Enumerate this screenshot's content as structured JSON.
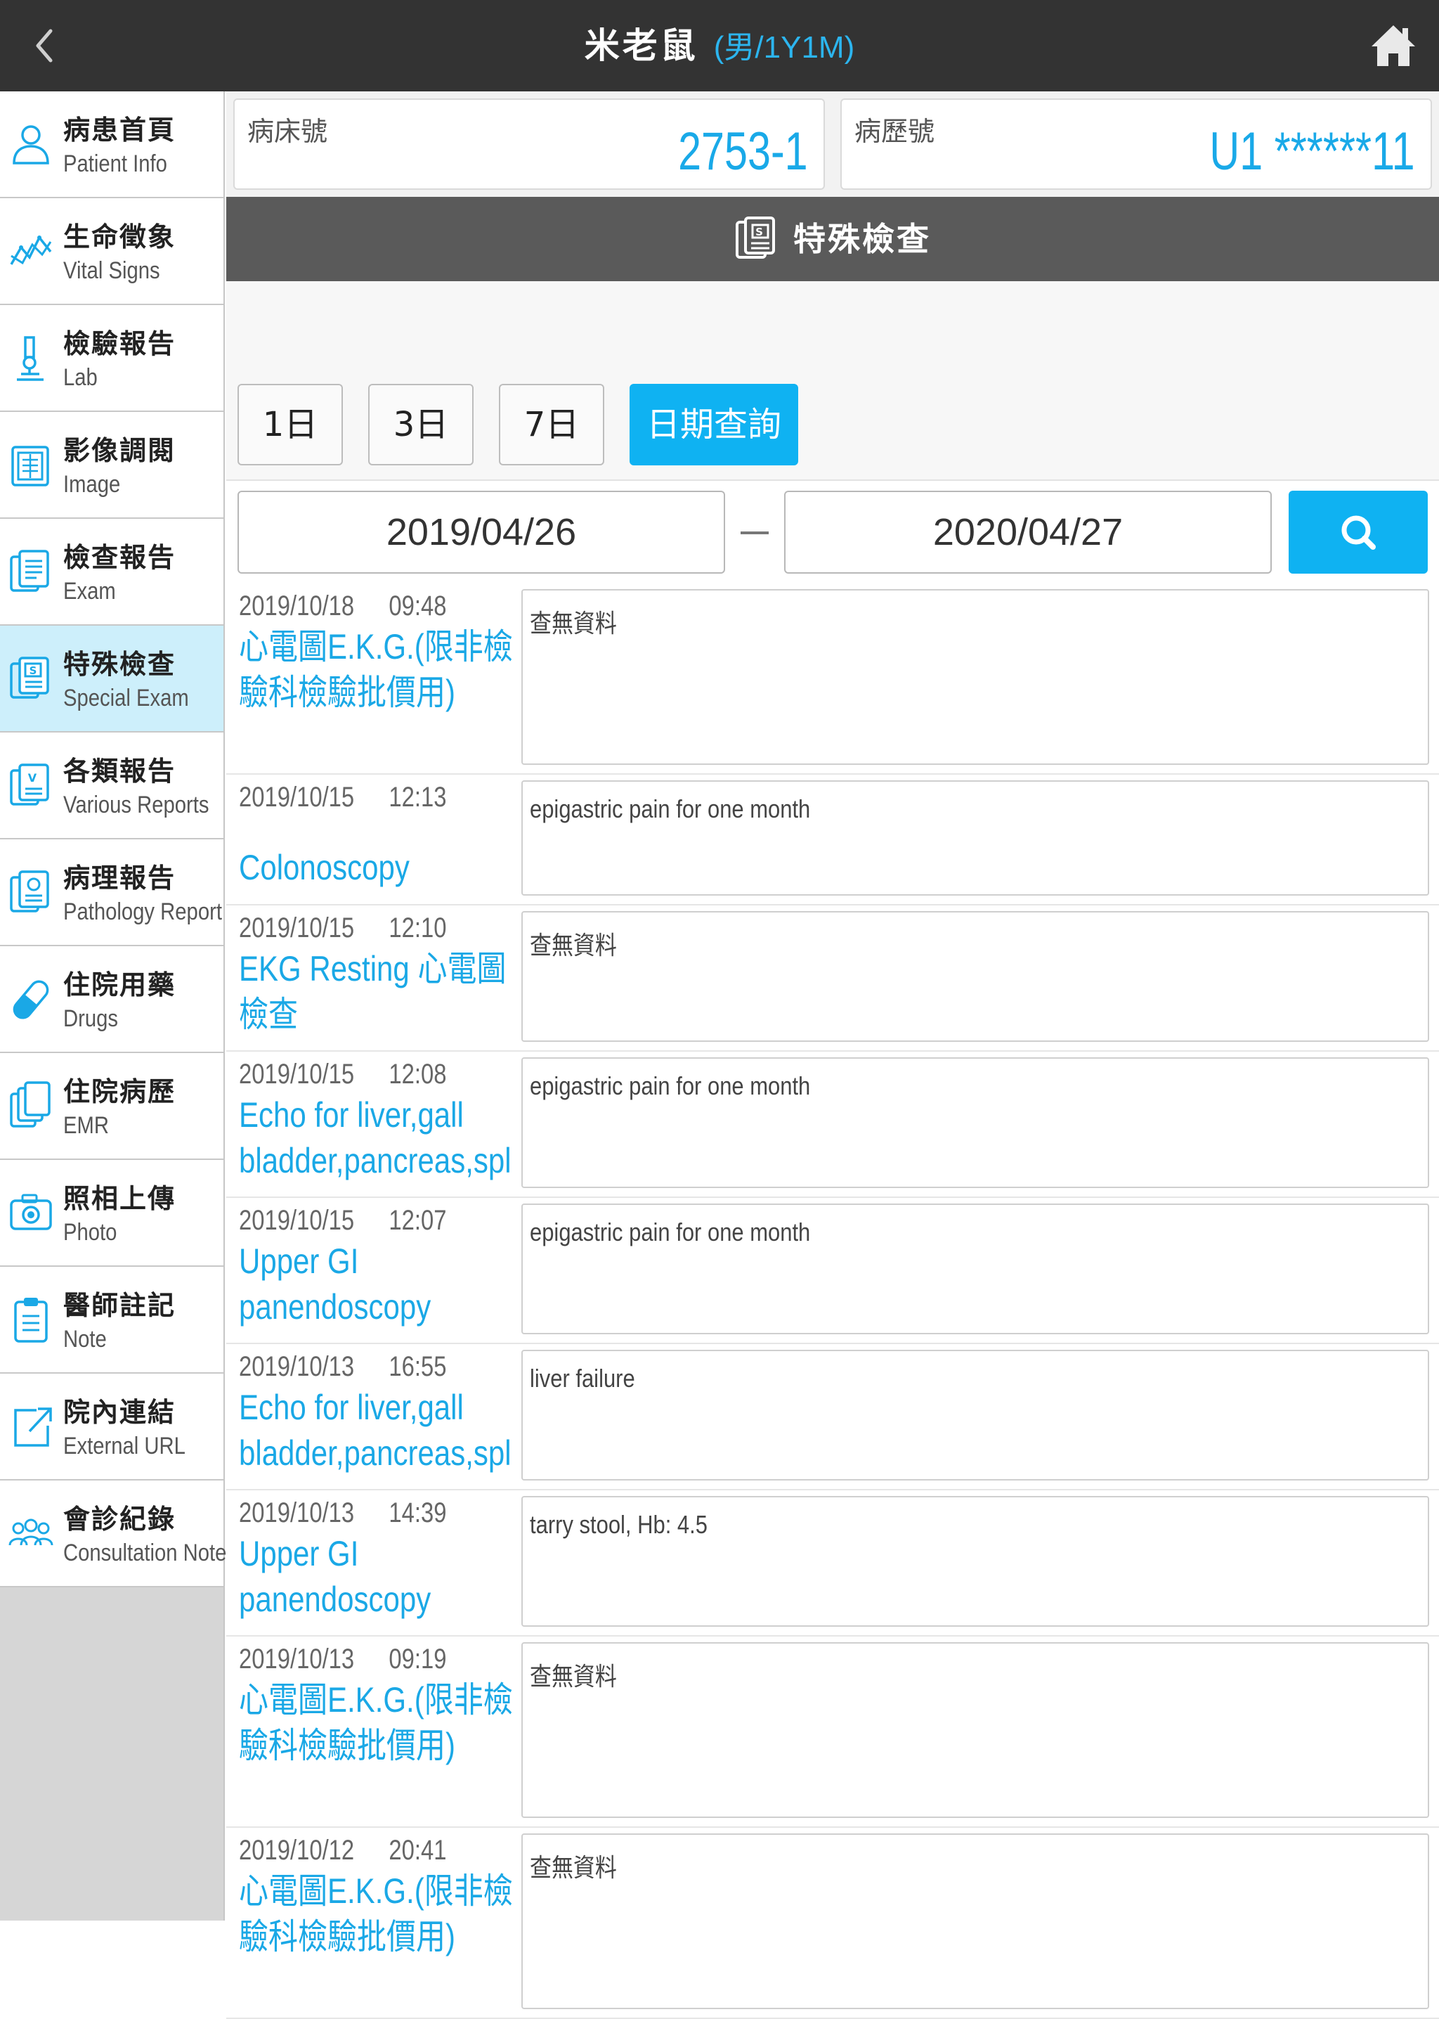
{
  "header": {
    "back_icon": "chevron-left-icon",
    "patient_name": "米老鼠",
    "patient_meta": "(男/1Y1M)",
    "home_icon": "home-icon"
  },
  "sidebar": {
    "items": [
      {
        "zh": "病患首頁",
        "en": "Patient Info",
        "icon": "user-icon"
      },
      {
        "zh": "生命徵象",
        "en": "Vital Signs",
        "icon": "chart-line-icon"
      },
      {
        "zh": "檢驗報告",
        "en": "Lab",
        "icon": "microscope-icon"
      },
      {
        "zh": "影像調閱",
        "en": "Image",
        "icon": "xray-icon"
      },
      {
        "zh": "檢查報告",
        "en": "Exam",
        "icon": "exam-doc-icon"
      },
      {
        "zh": "特殊檢查",
        "en": "Special Exam",
        "icon": "special-exam-icon"
      },
      {
        "zh": "各類報告",
        "en": "Various Reports",
        "icon": "various-reports-icon"
      },
      {
        "zh": "病理報告",
        "en": "Pathology Report",
        "icon": "pathology-icon"
      },
      {
        "zh": "住院用藥",
        "en": "Drugs",
        "icon": "pill-icon"
      },
      {
        "zh": "住院病歷",
        "en": "EMR",
        "icon": "copy-docs-icon"
      },
      {
        "zh": "照相上傳",
        "en": "Photo",
        "icon": "camera-icon"
      },
      {
        "zh": "醫師註記",
        "en": "Note",
        "icon": "clipboard-icon"
      },
      {
        "zh": "院內連結",
        "en": "External URL",
        "icon": "external-link-icon"
      },
      {
        "zh": "會診紀錄",
        "en": "Consultation Note",
        "icon": "group-icon"
      }
    ],
    "active_index": 5
  },
  "info": {
    "bed_label": "病床號",
    "bed_value": "2753-1",
    "chart_label": "病歷號",
    "chart_value": "U1 ******11"
  },
  "section": {
    "title": "特殊檢查",
    "icon": "special-exam-icon"
  },
  "filters": {
    "ranges": [
      "1日",
      "3日",
      "7日",
      "日期查詢"
    ],
    "active": "日期查詢",
    "date_from": "2019/04/26",
    "date_to": "2020/04/27",
    "search_icon": "search-icon"
  },
  "records": [
    {
      "date": "2019/10/18",
      "time": "09:48",
      "title": "心電圖E.K.G.(限非檢驗科檢驗批價用)",
      "note": "查無資料"
    },
    {
      "date": "2019/10/15",
      "time": "12:13",
      "title": "Colonoscopy",
      "note": "epigastric pain for one month"
    },
    {
      "date": "2019/10/15",
      "time": "12:10",
      "title": "EKG Resting 心電圖檢查",
      "note": "查無資料"
    },
    {
      "date": "2019/10/15",
      "time": "12:08",
      "title": "Echo for liver,gall bladder,pancreas,spl",
      "note": "epigastric pain for one month"
    },
    {
      "date": "2019/10/15",
      "time": "12:07",
      "title": "Upper GI panendoscopy",
      "note": "epigastric pain for one month"
    },
    {
      "date": "2019/10/13",
      "time": "16:55",
      "title": "Echo for liver,gall bladder,pancreas,spl",
      "note": "liver failure"
    },
    {
      "date": "2019/10/13",
      "time": "14:39",
      "title": "Upper GI panendoscopy",
      "note": "tarry stool, Hb: 4.5"
    },
    {
      "date": "2019/10/13",
      "time": "09:19",
      "title": "心電圖E.K.G.(限非檢驗科檢驗批價用)",
      "note": "查無資料"
    },
    {
      "date": "2019/10/12",
      "time": "20:41",
      "title": "心電圖E.K.G.(限非檢驗科檢驗批價用)",
      "note": "查無資料"
    }
  ]
}
